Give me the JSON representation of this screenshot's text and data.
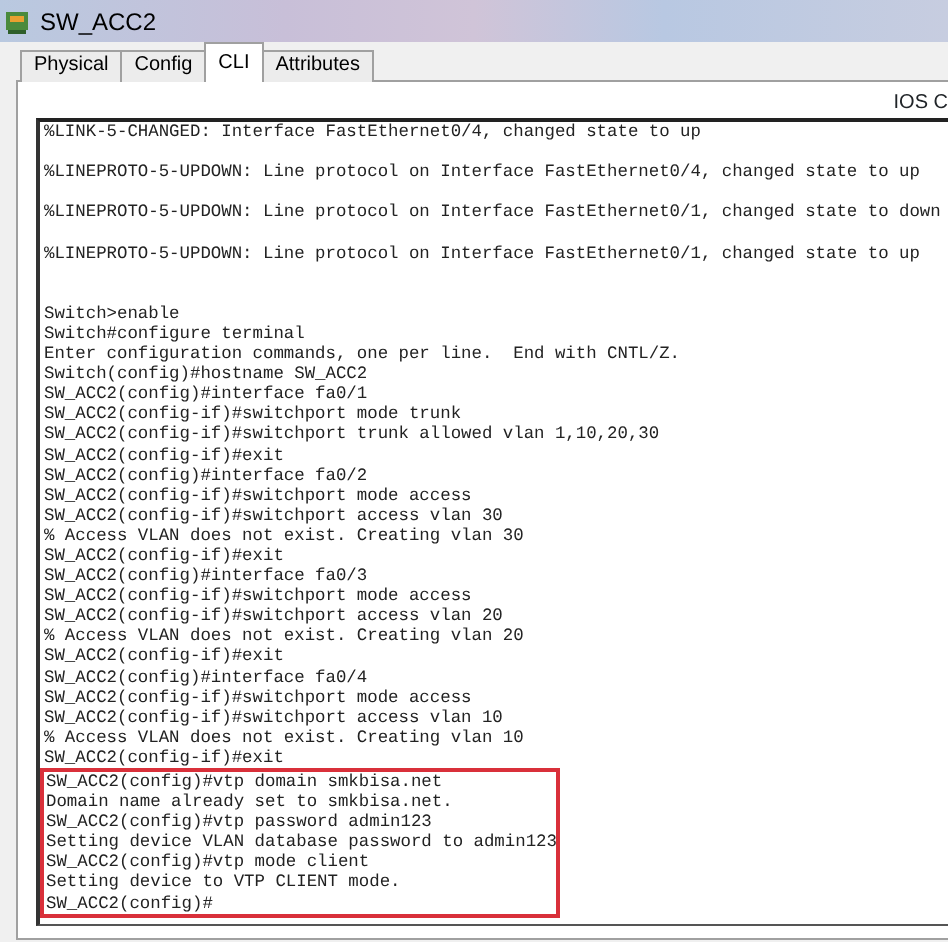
{
  "window": {
    "title": "SW_ACC2"
  },
  "tabs": [
    {
      "label": "Physical",
      "selected": false
    },
    {
      "label": "Config",
      "selected": false
    },
    {
      "label": "CLI",
      "selected": true
    },
    {
      "label": "Attributes",
      "selected": false
    }
  ],
  "panel_title": "IOS C",
  "terminal": {
    "lines": [
      {
        "kind": "text",
        "text": "%LINK-5-CHANGED: Interface FastEthernet0/4, changed state to up",
        "highlighted": false
      },
      {
        "kind": "blank"
      },
      {
        "kind": "text",
        "text": "%LINEPROTO-5-UPDOWN: Line protocol on Interface FastEthernet0/4, changed state to up",
        "highlighted": false
      },
      {
        "kind": "blank"
      },
      {
        "kind": "text",
        "text": "%LINEPROTO-5-UPDOWN: Line protocol on Interface FastEthernet0/1, changed state to down",
        "highlighted": false
      },
      {
        "kind": "blank"
      },
      {
        "kind": "text",
        "text": "%LINEPROTO-5-UPDOWN: Line protocol on Interface FastEthernet0/1, changed state to up",
        "highlighted": false
      },
      {
        "kind": "blank"
      },
      {
        "kind": "blank"
      },
      {
        "kind": "text",
        "text": "Switch>enable",
        "highlighted": false
      },
      {
        "kind": "text",
        "text": "Switch#configure terminal",
        "highlighted": false
      },
      {
        "kind": "text",
        "text": "Enter configuration commands, one per line.  End with CNTL/Z.",
        "highlighted": false
      },
      {
        "kind": "text",
        "text": "Switch(config)#hostname SW_ACC2",
        "highlighted": false
      },
      {
        "kind": "text",
        "text": "SW_ACC2(config)#interface fa0/1",
        "highlighted": false
      },
      {
        "kind": "text",
        "text": "SW_ACC2(config-if)#switchport mode trunk",
        "highlighted": false
      },
      {
        "kind": "text",
        "text": "SW_ACC2(config-if)#switchport trunk allowed vlan 1,10,20,30",
        "highlighted": false
      },
      {
        "kind": "text",
        "text": "SW_ACC2(config-if)#exit",
        "highlighted": false
      },
      {
        "kind": "text",
        "text": "SW_ACC2(config)#interface fa0/2",
        "highlighted": false
      },
      {
        "kind": "text",
        "text": "SW_ACC2(config-if)#switchport mode access",
        "highlighted": false
      },
      {
        "kind": "text",
        "text": "SW_ACC2(config-if)#switchport access vlan 30",
        "highlighted": false
      },
      {
        "kind": "text",
        "text": "% Access VLAN does not exist. Creating vlan 30",
        "highlighted": false
      },
      {
        "kind": "text",
        "text": "SW_ACC2(config-if)#exit",
        "highlighted": false
      },
      {
        "kind": "text",
        "text": "SW_ACC2(config)#interface fa0/3",
        "highlighted": false
      },
      {
        "kind": "text",
        "text": "SW_ACC2(config-if)#switchport mode access",
        "highlighted": false
      },
      {
        "kind": "text",
        "text": "SW_ACC2(config-if)#switchport access vlan 20",
        "highlighted": false
      },
      {
        "kind": "text",
        "text": "% Access VLAN does not exist. Creating vlan 20",
        "highlighted": false
      },
      {
        "kind": "text",
        "text": "SW_ACC2(config-if)#exit",
        "highlighted": false
      },
      {
        "kind": "text",
        "text": "SW_ACC2(config)#interface fa0/4",
        "highlighted": false
      },
      {
        "kind": "text",
        "text": "SW_ACC2(config-if)#switchport mode access",
        "highlighted": false
      },
      {
        "kind": "text",
        "text": "SW_ACC2(config-if)#switchport access vlan 10",
        "highlighted": false
      },
      {
        "kind": "text",
        "text": "% Access VLAN does not exist. Creating vlan 10",
        "highlighted": false
      },
      {
        "kind": "text",
        "text": "SW_ACC2(config-if)#exit",
        "highlighted": false
      },
      {
        "kind": "text",
        "text": "SW_ACC2(config)#vtp domain smkbisa.net",
        "highlighted": true
      },
      {
        "kind": "text",
        "text": "Domain name already set to smkbisa.net.",
        "highlighted": true
      },
      {
        "kind": "text",
        "text": "SW_ACC2(config)#vtp password admin123",
        "highlighted": true
      },
      {
        "kind": "text",
        "text": "Setting device VLAN database password to admin123",
        "highlighted": true
      },
      {
        "kind": "text",
        "text": "SW_ACC2(config)#vtp mode client",
        "highlighted": true
      },
      {
        "kind": "text",
        "text": "Setting device to VTP CLIENT mode.",
        "highlighted": true
      },
      {
        "kind": "text",
        "text": "SW_ACC2(config)#",
        "highlighted": true
      }
    ]
  }
}
